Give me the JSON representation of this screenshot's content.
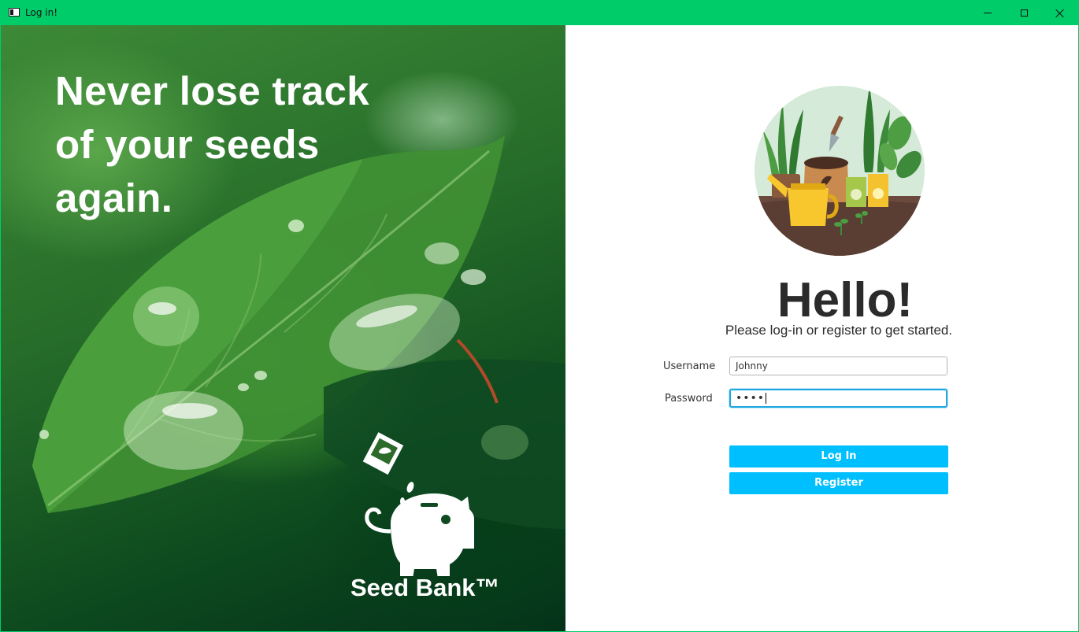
{
  "window": {
    "title": "Log in!",
    "icon": "window-app-icon",
    "controls": {
      "minimize": "minimize-icon",
      "maximize": "maximize-icon",
      "close": "close-icon"
    },
    "accent_color": "#00cc6a"
  },
  "hero": {
    "headline_lines": [
      "Never lose track",
      "of your seeds",
      "again."
    ],
    "brand_name": "Seed Bank™",
    "logo_icon": "piggy-bank-seed-packet-icon"
  },
  "login": {
    "illustration": "garden-illustration",
    "greeting": "Hello!",
    "subtitle": "Please log-in or register to get started.",
    "username_label": "Username",
    "username_value": "Johnny",
    "password_label": "Password",
    "password_masked": "••••",
    "login_button": "Log In",
    "register_button": "Register",
    "button_color": "#00bfff"
  }
}
